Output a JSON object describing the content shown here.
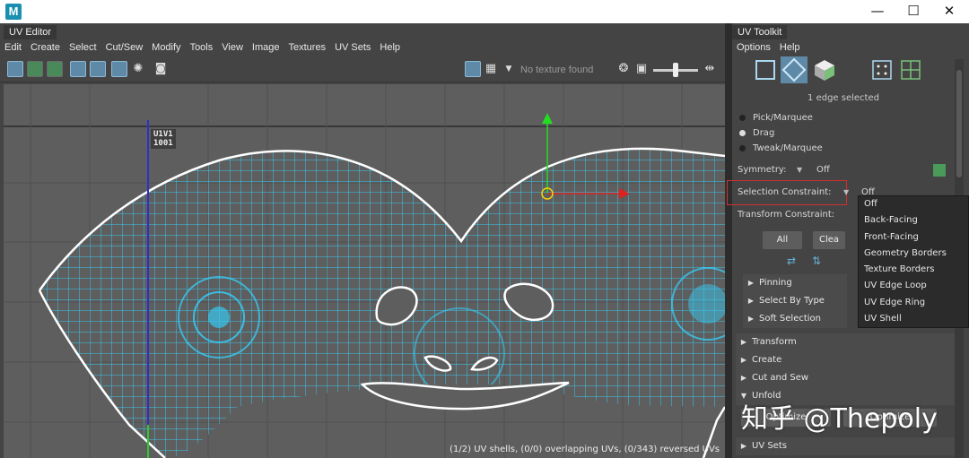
{
  "os": {
    "app_icon": "maya-logo",
    "minimize": "—",
    "maximize": "☐",
    "close": "✕"
  },
  "uv_editor": {
    "tab": "UV Editor",
    "menu": [
      "Edit",
      "Create",
      "Select",
      "Cut/Sew",
      "Modify",
      "Tools",
      "View",
      "Image",
      "Textures",
      "UV Sets",
      "Help"
    ],
    "texture_field": "No texture found",
    "tile_label_line1": "U1V1",
    "tile_label_line2": "1001",
    "status": "(1/2) UV shells, (0/0) overlapping UVs, (0/343) reversed UVs"
  },
  "toolkit": {
    "tab": "UV Toolkit",
    "menu": [
      "Options",
      "Help"
    ],
    "selection_status": "1 edge selected",
    "modes": [
      {
        "label": "Pick/Marquee",
        "selected": false
      },
      {
        "label": "Drag",
        "selected": true
      },
      {
        "label": "Tweak/Marquee",
        "selected": false
      }
    ],
    "symmetry_label": "Symmetry:",
    "symmetry_value": "Off",
    "selection_constraint_label": "Selection Constraint:",
    "selection_constraint_value": "Off",
    "transform_constraint_label": "Transform Constraint:",
    "all_button": "All",
    "clear_button": "Clea",
    "sub_sections": [
      "Pinning",
      "Select By Type",
      "Soft Selection"
    ],
    "sections": [
      "Transform",
      "Create",
      "Cut and Sew",
      "Unfold"
    ],
    "unfold_buttons": [
      "Optimize",
      "Optimize"
    ],
    "uv_sets_section": "UV Sets"
  },
  "dropdown": {
    "items": [
      "Off",
      "Back-Facing",
      "Front-Facing",
      "Geometry Borders",
      "Texture Borders",
      "UV Edge Loop",
      "UV Edge Ring",
      "UV Shell"
    ]
  },
  "watermark": "知乎 @Thepoly",
  "colors": {
    "uv_wire": "#37c8f0",
    "border": "#ffffff",
    "accent": "#5e8aa8",
    "highlight_box": "#d03030"
  }
}
